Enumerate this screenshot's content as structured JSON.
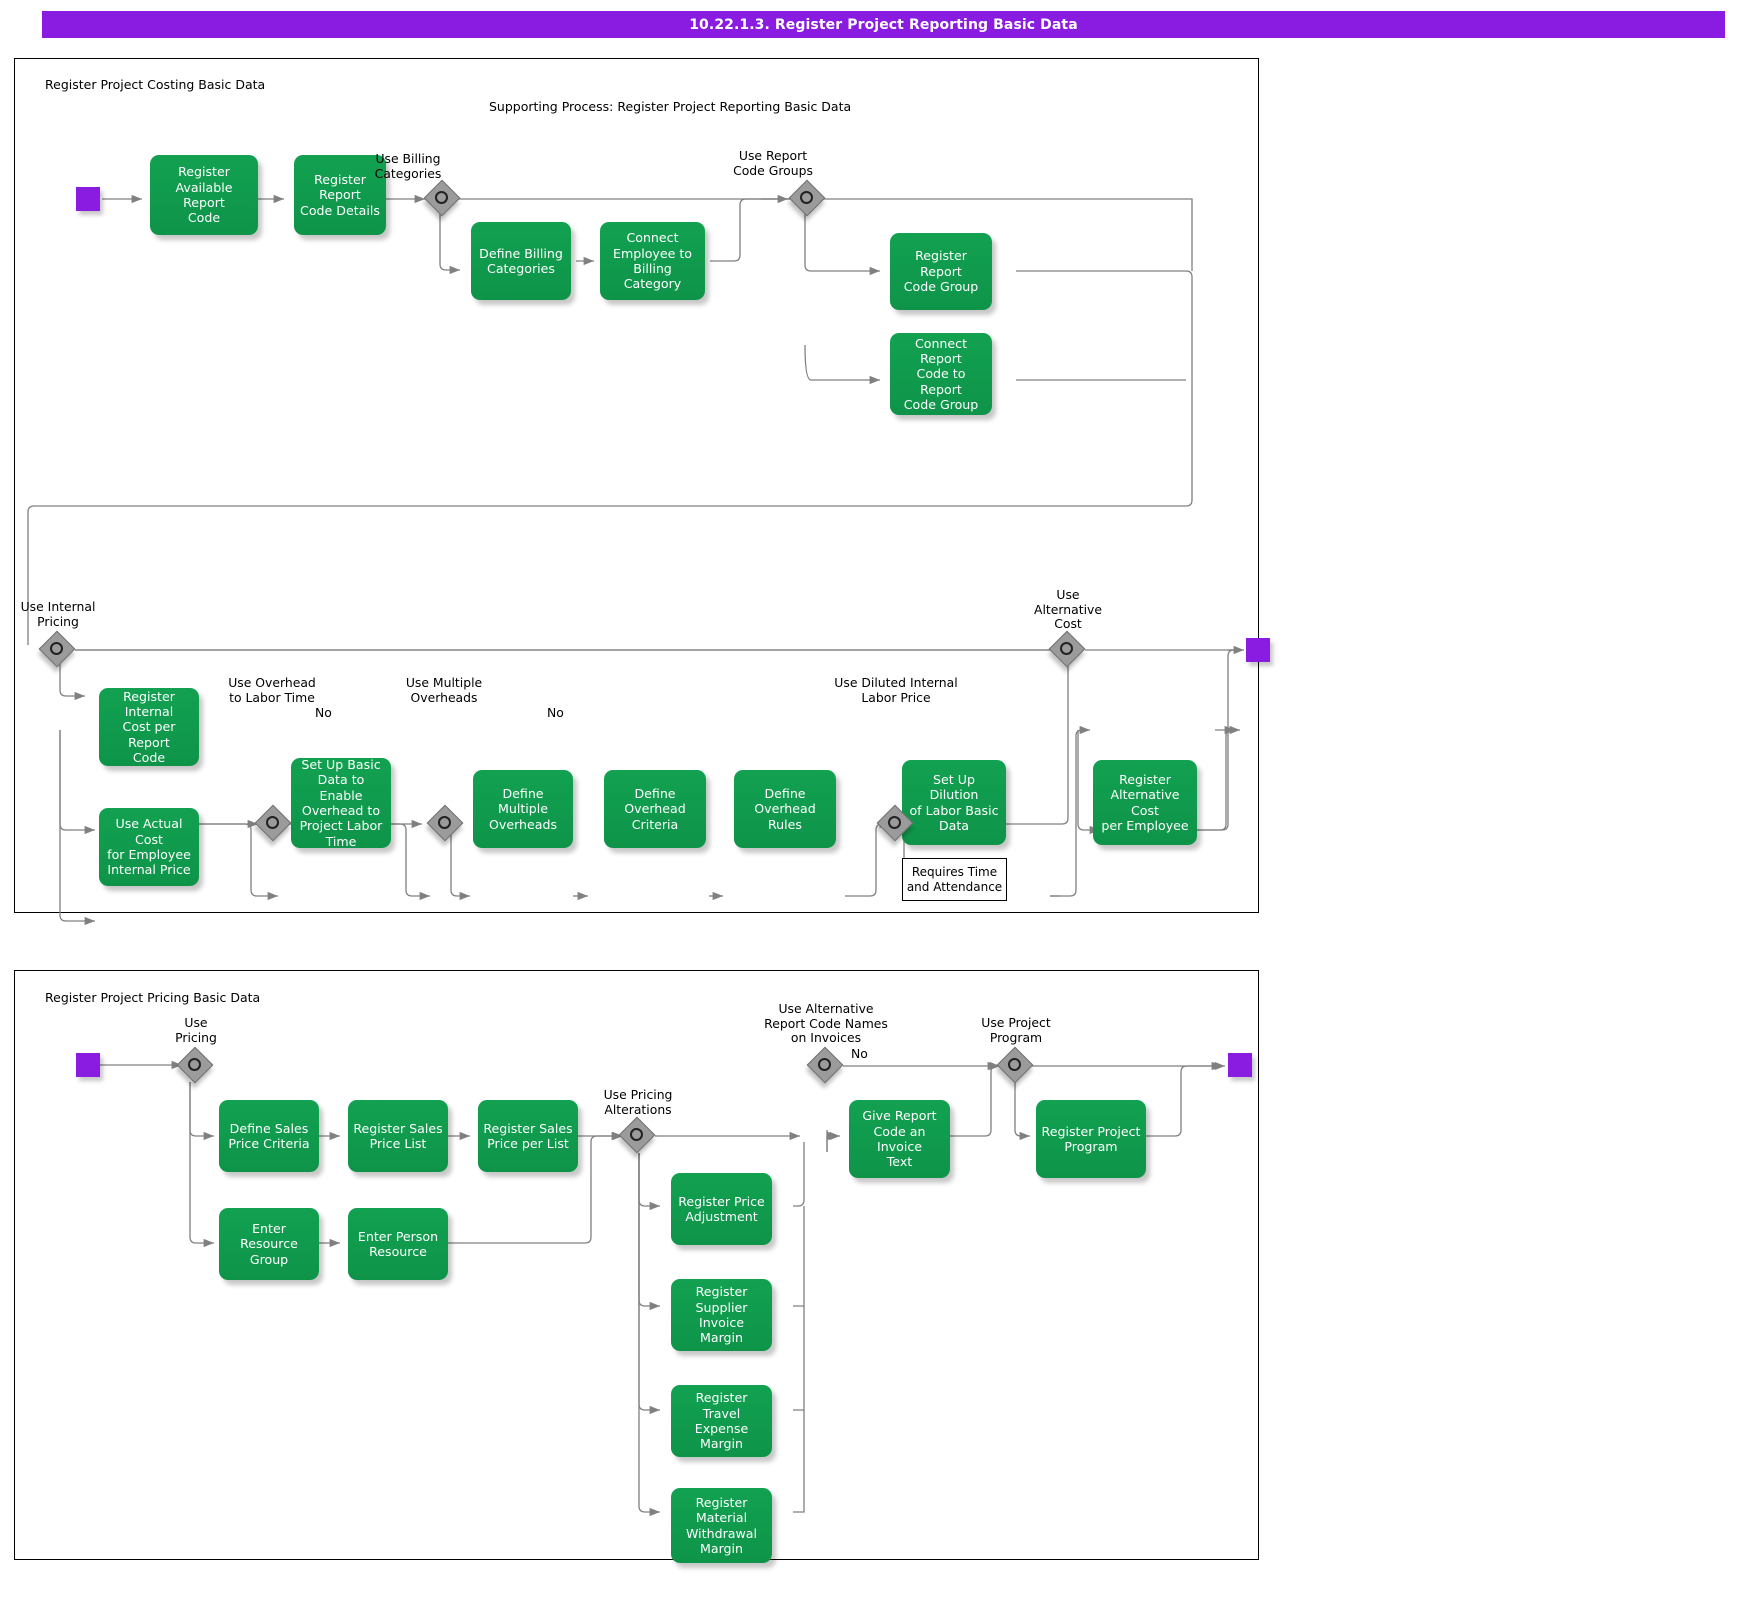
{
  "header": {
    "title": "10.22.1.3. Register Project Reporting Basic Data"
  },
  "pools": [
    {
      "id": "costing",
      "label": "Register Project Costing Basic Data",
      "subtitle": "Supporting Process: Register Project Reporting Basic Data"
    },
    {
      "id": "pricing",
      "label": "Register Project Pricing Basic Data"
    }
  ],
  "costing": {
    "tasks": [
      {
        "id": "register-available-report-code",
        "label": "Register\nAvailable Report\nCode"
      },
      {
        "id": "register-report-code-details",
        "label": "Register Report\nCode Details"
      },
      {
        "id": "define-billing-categories",
        "label": "Define Billing\nCategories"
      },
      {
        "id": "connect-employee-to-billing-category",
        "label": "Connect\nEmployee to\nBilling Category"
      },
      {
        "id": "register-report-code-group",
        "label": "Register Report\nCode Group"
      },
      {
        "id": "connect-report-code-to-report-code-group",
        "label": "Connect Report\nCode to Report\nCode Group"
      },
      {
        "id": "register-internal-cost-per-report-code",
        "label": "Register Internal\nCost per Report\nCode"
      },
      {
        "id": "use-actual-cost-for-employee-internal-price",
        "label": "Use Actual Cost\nfor Employee\nInternal Price"
      },
      {
        "id": "set-up-basic-data-to-enable-overhead",
        "label": "Set Up Basic\nData to Enable\nOverhead to\nProject Labor\nTime"
      },
      {
        "id": "define-multiple-overheads",
        "label": "Define\nMultiple\nOverheads"
      },
      {
        "id": "define-overhead-criteria",
        "label": "Define Overhead\nCriteria"
      },
      {
        "id": "define-overhead-rules",
        "label": "Define Overhead\nRules"
      },
      {
        "id": "set-up-dilution-of-labor-basic-data",
        "label": "Set Up Dilution\nof Labor Basic\nData"
      },
      {
        "id": "register-alternative-cost-per-employee",
        "label": "Register\nAlternative Cost\nper Employee"
      }
    ],
    "gateways": [
      {
        "id": "use-billing-categories",
        "label": "Use Billing\nCategories"
      },
      {
        "id": "use-report-code-groups",
        "label": "Use Report\nCode Groups"
      },
      {
        "id": "use-internal-pricing",
        "label": "Use Internal\nPricing"
      },
      {
        "id": "use-overhead-to-labor-time",
        "label": "Use Overhead\nto Labor Time"
      },
      {
        "id": "use-multiple-overheads",
        "label": "Use Multiple\nOverheads"
      },
      {
        "id": "use-diluted-internal-labor-price",
        "label": "Use Diluted Internal\nLabor Price"
      },
      {
        "id": "use-alternative-cost",
        "label": "Use\nAlternative\nCost"
      }
    ],
    "edge_labels": [
      {
        "id": "no-overhead",
        "text": "No"
      },
      {
        "id": "no-multiple-overheads",
        "text": "No"
      }
    ],
    "notes": [
      {
        "id": "requires-time-and-attendance",
        "text": "Requires Time\nand Attendance"
      }
    ]
  },
  "pricing": {
    "tasks": [
      {
        "id": "define-sales-price-criteria",
        "label": "Define Sales\nPrice Criteria"
      },
      {
        "id": "register-sales-price-list",
        "label": "Register Sales\nPrice List"
      },
      {
        "id": "register-sales-price-per-list",
        "label": "Register Sales\nPrice per List"
      },
      {
        "id": "enter-resource-group",
        "label": "Enter Resource\nGroup"
      },
      {
        "id": "enter-person-resource",
        "label": "Enter Person\nResource"
      },
      {
        "id": "register-price-adjustment",
        "label": "Register Price\nAdjustment"
      },
      {
        "id": "register-supplier-invoice-margin",
        "label": "Register\nSupplier Invoice\nMargin"
      },
      {
        "id": "register-travel-expense-margin",
        "label": "Register Travel\nExpense Margin"
      },
      {
        "id": "register-material-withdrawal-margin",
        "label": "Register Material\nWithdrawal\nMargin"
      },
      {
        "id": "give-report-code-an-invoice-text",
        "label": "Give Report\nCode an Invoice\nText"
      },
      {
        "id": "register-project-program",
        "label": "Register Project\nProgram"
      }
    ],
    "gateways": [
      {
        "id": "use-pricing",
        "label": "Use\nPricing"
      },
      {
        "id": "use-pricing-alterations",
        "label": "Use Pricing\nAlterations"
      },
      {
        "id": "use-alternative-report-code-names-on-invoices",
        "label": "Use Alternative\nReport Code Names\non Invoices"
      },
      {
        "id": "use-project-program",
        "label": "Use Project\nProgram"
      }
    ],
    "edge_labels": [
      {
        "id": "no-alt-report-code-names",
        "text": "No"
      }
    ]
  },
  "colors": {
    "title_bar": "#8A1BE0",
    "task_fill": "#0F9D4F",
    "terminator": "#8A1BE0",
    "gateway": "#9B9B9B",
    "connector": "#808080"
  }
}
